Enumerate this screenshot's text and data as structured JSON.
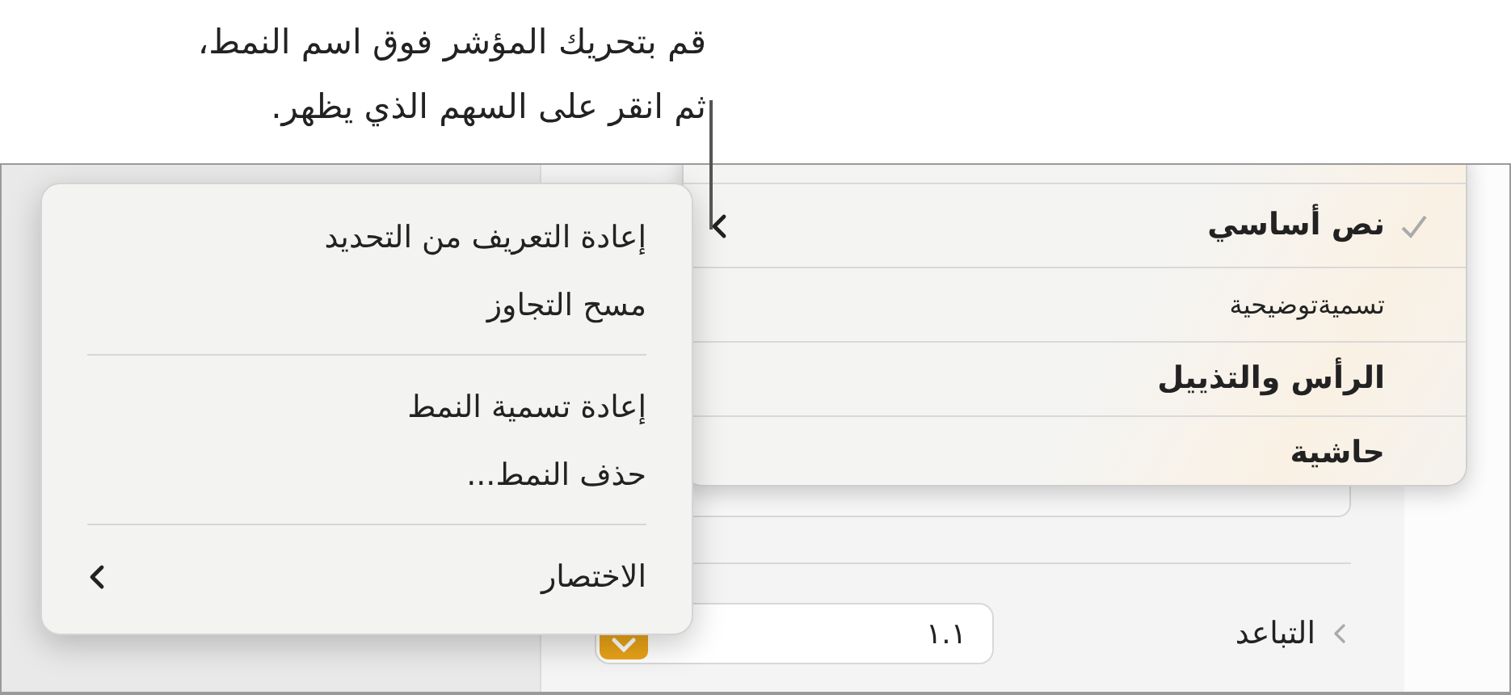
{
  "callout": {
    "lines": [
      "قم بتحريك المؤشر فوق اسم النمط،",
      "ثم انقر على السهم الذي يظهر."
    ]
  },
  "style_menu": {
    "items": [
      {
        "label": "نص أساسي",
        "checked": true,
        "arrow": true,
        "kind": "heading"
      },
      {
        "label": "تسميةتوضيحية",
        "checked": false,
        "arrow": false,
        "kind": "caption"
      },
      {
        "label": "الرأس والتذييل",
        "checked": false,
        "arrow": false,
        "kind": "heading"
      },
      {
        "label": "حاشية",
        "checked": false,
        "arrow": false,
        "kind": "heading"
      }
    ]
  },
  "context_menu": {
    "sections": [
      {
        "items": [
          {
            "label": "إعادة التعريف من التحديد",
            "submenu": false
          },
          {
            "label": "مسح التجاوز",
            "submenu": false
          }
        ]
      },
      {
        "items": [
          {
            "label": "إعادة تسمية النمط",
            "submenu": false
          },
          {
            "label": "حذف النمط...",
            "submenu": false
          }
        ]
      },
      {
        "items": [
          {
            "label": "الاختصار",
            "submenu": true
          }
        ]
      }
    ]
  },
  "spacing": {
    "label": "التباعد",
    "value": "١.١"
  }
}
